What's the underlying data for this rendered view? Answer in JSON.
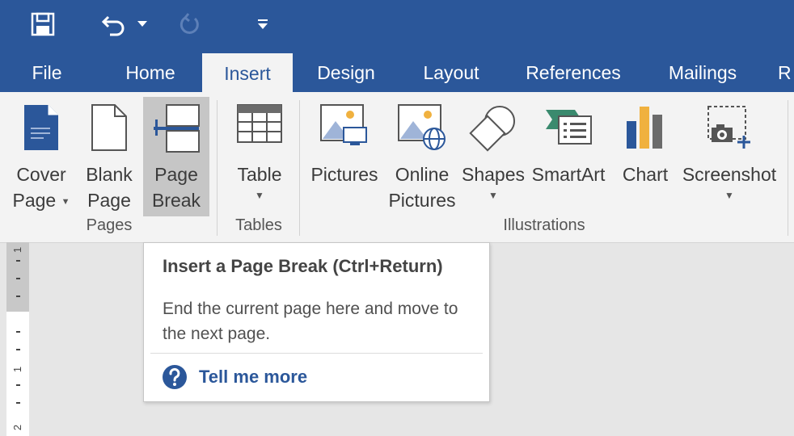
{
  "quick_access": {
    "save_icon": "save-icon",
    "undo_icon": "undo-icon",
    "undo_dropdown_icon": "chevron-down-icon",
    "redo_icon": "repeat-icon",
    "customize_icon": "customize-qat-icon"
  },
  "tabs": [
    {
      "label": "File"
    },
    {
      "label": "Home"
    },
    {
      "label": "Insert"
    },
    {
      "label": "Design"
    },
    {
      "label": "Layout"
    },
    {
      "label": "References"
    },
    {
      "label": "Mailings"
    },
    {
      "label": "R"
    }
  ],
  "ribbon": {
    "groups": {
      "pages": {
        "label": "Pages",
        "cover_page": {
          "line1": "Cover",
          "line2": "Page"
        },
        "blank_page": {
          "line1": "Blank",
          "line2": "Page"
        },
        "page_break": {
          "line1": "Page",
          "line2": "Break"
        }
      },
      "tables": {
        "label": "Tables",
        "table": {
          "line1": "Table"
        }
      },
      "illustrations": {
        "label": "Illustrations",
        "pictures": {
          "line1": "Pictures"
        },
        "online_pictures": {
          "line1": "Online",
          "line2": "Pictures"
        },
        "shapes": {
          "line1": "Shapes"
        },
        "smartart": {
          "line1": "SmartArt"
        },
        "chart": {
          "line1": "Chart"
        },
        "screenshot": {
          "line1": "Screenshot"
        }
      }
    }
  },
  "ruler": {
    "numbers": [
      "1",
      "1",
      "2"
    ]
  },
  "tooltip": {
    "title": "Insert a Page Break (Ctrl+Return)",
    "description": "End the current page here and move to the next page.",
    "help_link": "Tell me more"
  },
  "colors": {
    "accent": "#2b579a",
    "ribbon": "#f3f3f3",
    "selected": "#c6c6c6"
  }
}
